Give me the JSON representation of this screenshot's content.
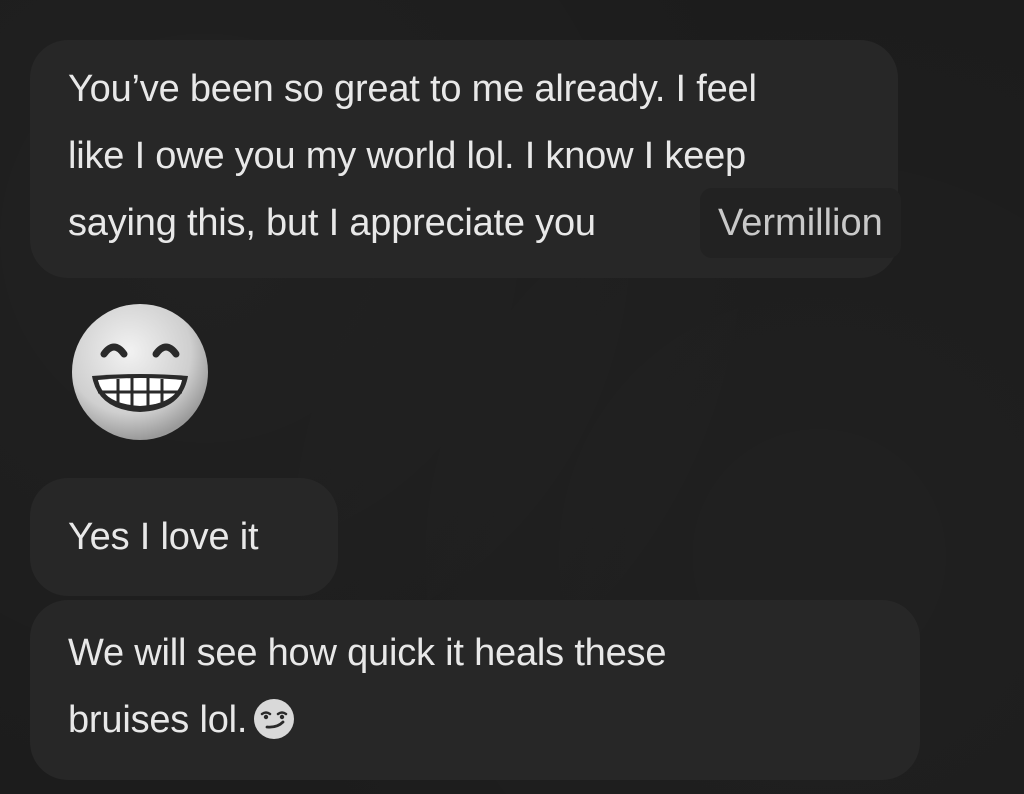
{
  "messages": [
    {
      "lines": [
        "You’ve been so great to me already. I feel",
        "like I owe you my world lol. I know I keep",
        "saying this, but I appreciate you"
      ],
      "mention": "Vermillion"
    },
    {
      "emoji": "grinning-face-with-smiling-eyes"
    },
    {
      "lines": [
        "Yes I love it"
      ]
    },
    {
      "lines": [
        "We will see how quick it heals these",
        "bruises lol."
      ],
      "trailing_emoji": "smirking-face"
    }
  ],
  "colors": {
    "background": "#1c1c1c",
    "bubble": "#272727",
    "text": "#e8e8e8"
  }
}
